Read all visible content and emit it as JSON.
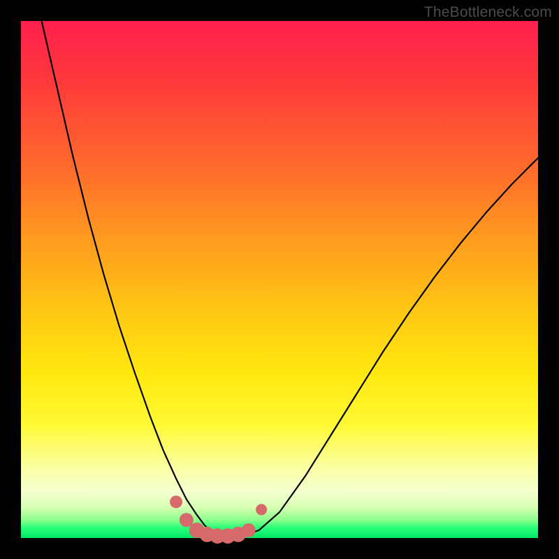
{
  "watermark": "TheBottleneck.com",
  "chart_data": {
    "type": "line",
    "title": "",
    "xlabel": "",
    "ylabel": "",
    "xlim": [
      0,
      1
    ],
    "ylim": [
      0,
      1
    ],
    "series": [
      {
        "name": "bottleneck-curve",
        "x": [
          0.04,
          0.07,
          0.1,
          0.13,
          0.16,
          0.19,
          0.22,
          0.25,
          0.275,
          0.3,
          0.32,
          0.34,
          0.355,
          0.37,
          0.4,
          0.43,
          0.46,
          0.5,
          0.55,
          0.6,
          0.65,
          0.7,
          0.75,
          0.8,
          0.85,
          0.9,
          0.95,
          1.0
        ],
        "y": [
          1.0,
          0.87,
          0.74,
          0.62,
          0.51,
          0.41,
          0.32,
          0.235,
          0.17,
          0.115,
          0.075,
          0.045,
          0.025,
          0.01,
          0.005,
          0.005,
          0.015,
          0.05,
          0.12,
          0.2,
          0.28,
          0.36,
          0.435,
          0.505,
          0.57,
          0.63,
          0.685,
          0.735
        ]
      }
    ],
    "markers": {
      "name": "curve-markers",
      "color": "#d66a6a",
      "points_x": [
        0.3,
        0.32,
        0.34,
        0.36,
        0.38,
        0.4,
        0.42,
        0.44,
        0.465
      ],
      "points_y": [
        0.07,
        0.035,
        0.015,
        0.007,
        0.004,
        0.004,
        0.007,
        0.015,
        0.055
      ],
      "radius": [
        9,
        10,
        11,
        11,
        11,
        11,
        11,
        10,
        8
      ]
    },
    "gradient_stops": [
      {
        "pos": 0.0,
        "color": "#ff1f4d"
      },
      {
        "pos": 0.28,
        "color": "#ff6a2d"
      },
      {
        "pos": 0.55,
        "color": "#ffc414"
      },
      {
        "pos": 0.78,
        "color": "#fff933"
      },
      {
        "pos": 0.94,
        "color": "#d9ffb3"
      },
      {
        "pos": 1.0,
        "color": "#00e765"
      }
    ]
  }
}
